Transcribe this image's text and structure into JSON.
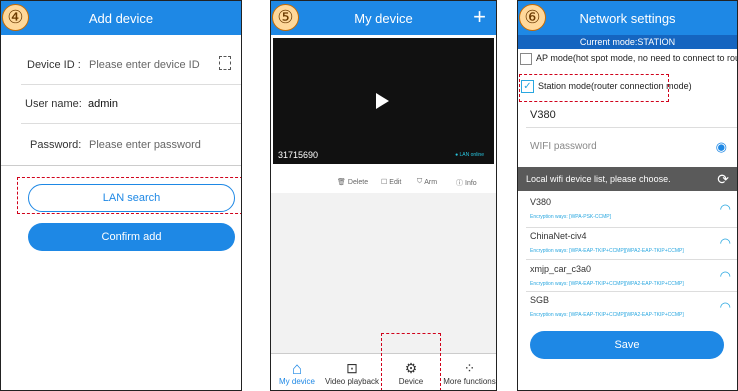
{
  "step_labels": [
    "④",
    "⑤",
    "⑥"
  ],
  "screen1": {
    "title": "Add device",
    "device_id_label": "Device ID :",
    "device_id_placeholder": "Please enter device ID",
    "user_label": "User name:",
    "user_value": "admin",
    "password_label": "Password:",
    "password_placeholder": "Please enter password",
    "lan_search": "LAN search",
    "confirm_add": "Confirm add"
  },
  "screen2": {
    "title": "My device",
    "device_number": "31715690",
    "status": "LAN online",
    "actions": [
      "Delete",
      "Edit",
      "Arm",
      "Info"
    ],
    "nav": [
      "My device",
      "Video playback",
      "Device",
      "More functions"
    ]
  },
  "screen3": {
    "title": "Network settings",
    "current_mode": "Current mode:STATION",
    "ap_mode": "AP mode(hot spot mode, no need to connect to router)",
    "station_mode": "Station mode(router connection mode)",
    "ssid": "V380",
    "wifi_password_placeholder": "WIFI password",
    "list_header": "Local wifi device list, please choose.",
    "networks": [
      {
        "name": "V380",
        "enc": "Encryption ways: [WPA-PSK-CCMP]"
      },
      {
        "name": "ChinaNet-civ4",
        "enc": "Encryption ways: [WPA-EAP-TKIP+CCMP][WPA2-EAP-TKIP+CCMP]"
      },
      {
        "name": "xmjp_car_c3a0",
        "enc": "Encryption ways: [WPA-EAP-TKIP+CCMP][WPA2-EAP-TKIP+CCMP]"
      },
      {
        "name": "SGB",
        "enc": "Encryption ways: [WPA-EAP-TKIP+CCMP][WPA2-EAP-TKIP+CCMP]"
      }
    ],
    "save": "Save"
  },
  "colors": {
    "brand_blue": "#1e88e5",
    "highlight_red": "#d0021b",
    "station_bar": "#1565c0"
  }
}
